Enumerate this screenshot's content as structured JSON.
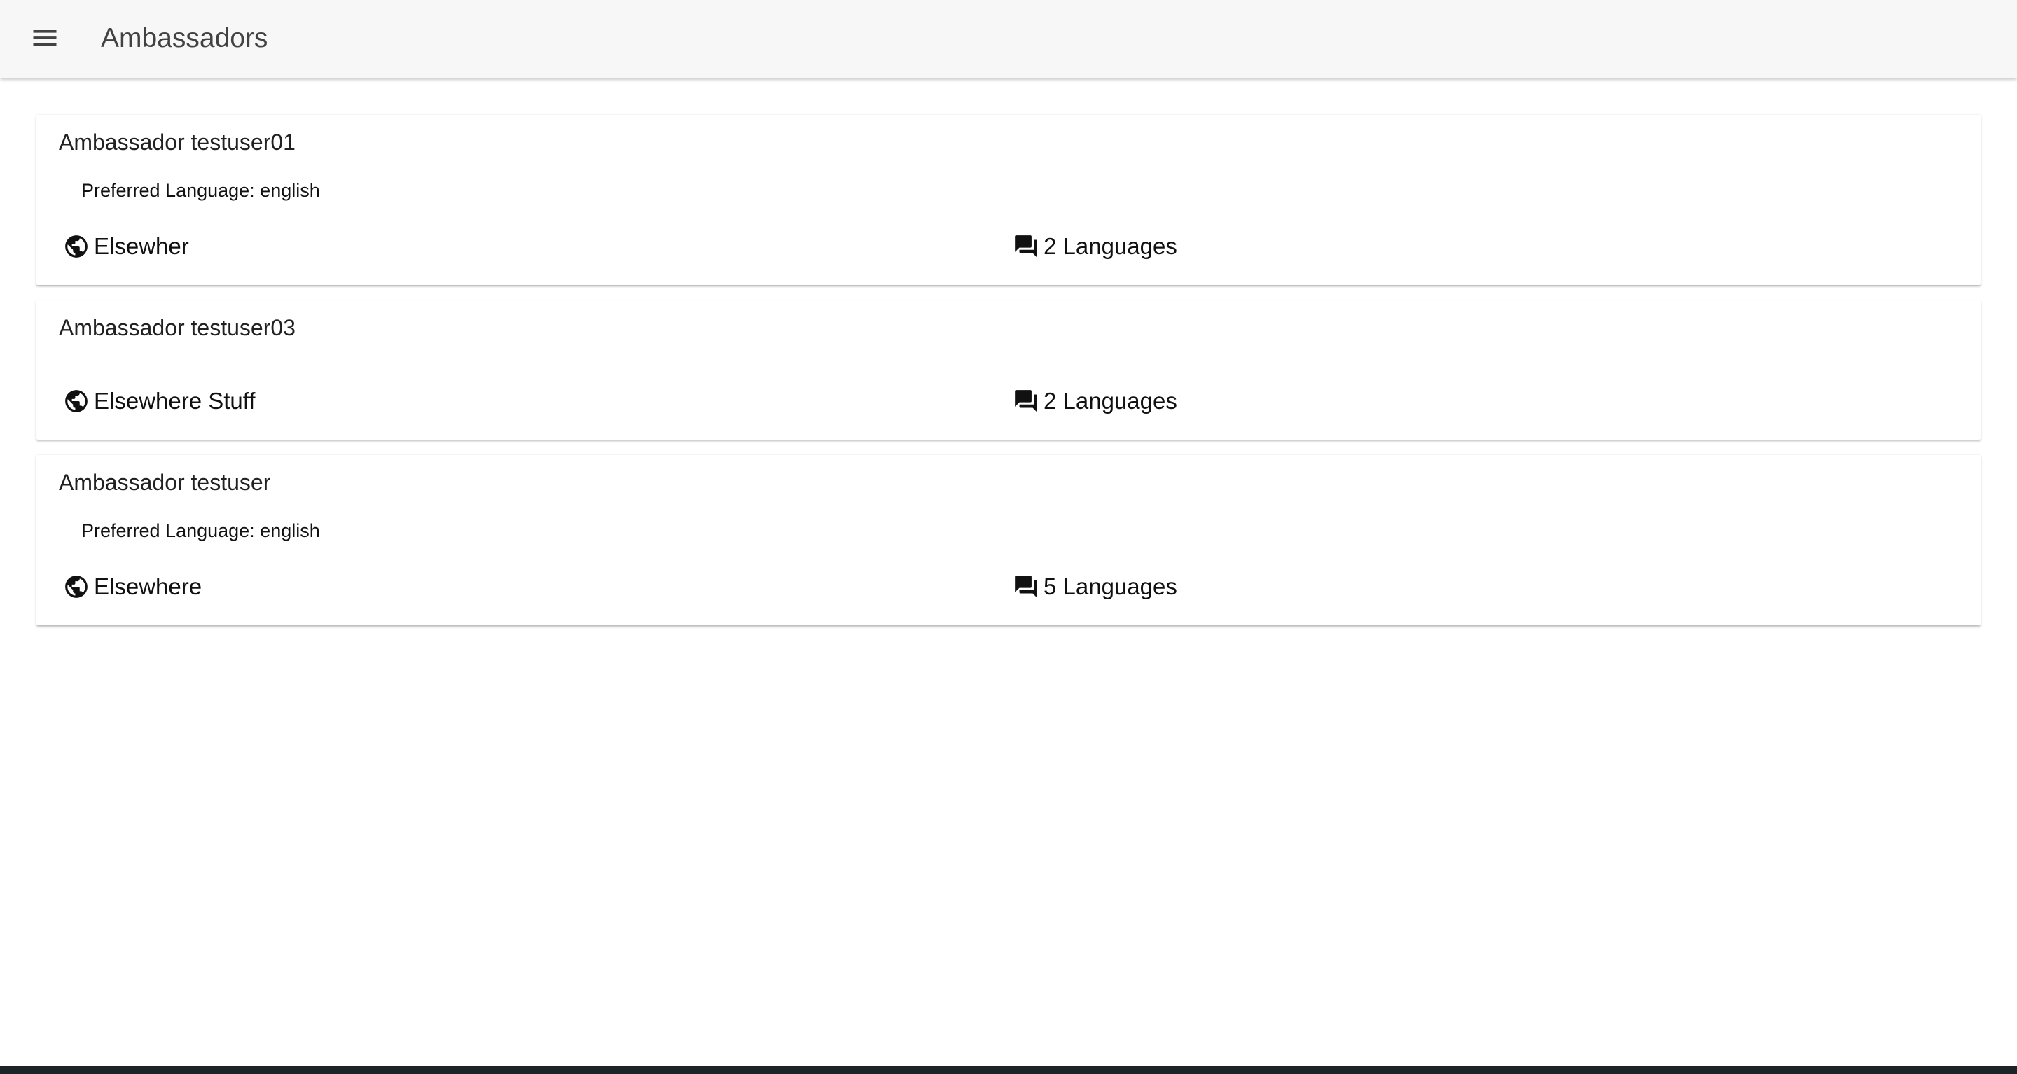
{
  "toolbar": {
    "menu_icon": "menu-icon",
    "title": "Ambassadors"
  },
  "ambassadors": [
    {
      "title": "Ambassador testuser01",
      "preferred_language": "Preferred Language: english",
      "location": "Elsewher",
      "location_icon": "globe-icon",
      "languages": "2 Languages",
      "languages_icon": "chat-bubbles-icon"
    },
    {
      "title": "Ambassador testuser03",
      "preferred_language": "",
      "location": "Elsewhere Stuff",
      "location_icon": "globe-icon",
      "languages": "2 Languages",
      "languages_icon": "chat-bubbles-icon"
    },
    {
      "title": "Ambassador testuser",
      "preferred_language": "Preferred Language: english",
      "location": "Elsewhere",
      "location_icon": "globe-icon",
      "languages": "5 Languages",
      "languages_icon": "chat-bubbles-icon"
    }
  ],
  "colors": {
    "toolbar_bg": "#f7f7f7",
    "page_bg": "#ffffff",
    "text": "#212121",
    "bottom_strip": "#1c2428"
  }
}
